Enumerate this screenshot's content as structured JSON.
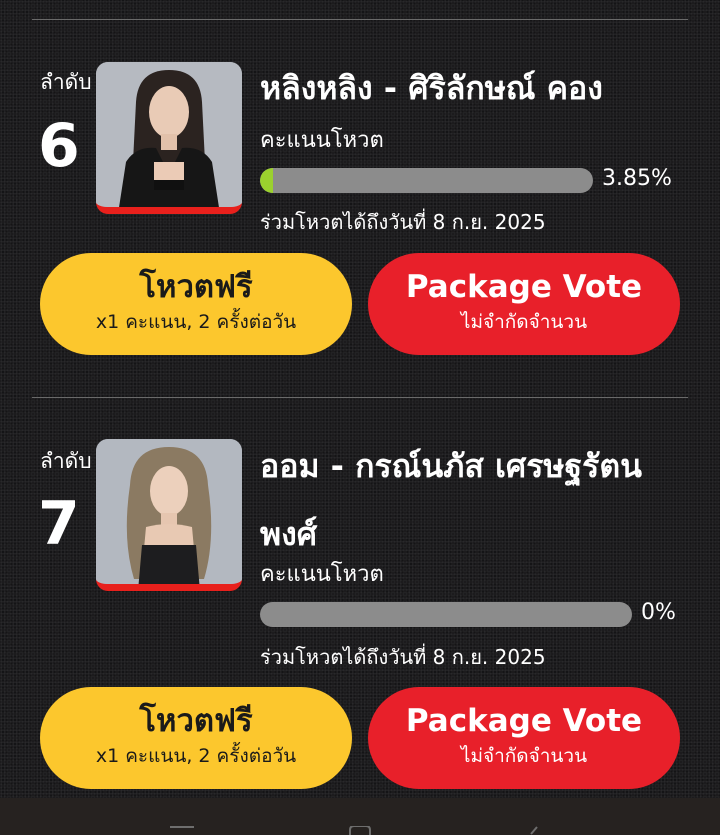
{
  "candidates": [
    {
      "rank_label": "ลำดับ",
      "rank": "6",
      "name": "หลิงหลิง - ศิริลักษณ์ คอง",
      "score_label": "คะแนนโหวต",
      "percent_text": "3.85%",
      "percent_value": 3.85,
      "until_text": "ร่วมโหวตได้ถึงวันที่ 8 ก.ย. 2025",
      "free_vote": {
        "title": "โหวตฟรี",
        "subtitle": "x1 คะแนน, 2 ครั้งต่อวัน"
      },
      "package_vote": {
        "title": "Package Vote",
        "subtitle": "ไม่จำกัดจำนวน"
      }
    },
    {
      "rank_label": "ลำดับ",
      "rank": "7",
      "name": "ออม - กรณ์นภัส เศรษฐรัตนพงศ์",
      "score_label": "คะแนนโหวต",
      "percent_text": "0%",
      "percent_value": 0,
      "until_text": "ร่วมโหวตได้ถึงวันที่ 8 ก.ย. 2025",
      "free_vote": {
        "title": "โหวตฟรี",
        "subtitle": "x1 คะแนน, 2 ครั้งต่อวัน"
      },
      "package_vote": {
        "title": "Package Vote",
        "subtitle": "ไม่จำกัดจำนวน"
      }
    }
  ],
  "colors": {
    "free_button": "#fcc72d",
    "package_button": "#e8202a",
    "progress_fill": "#9bd12e",
    "progress_track": "#8c8c8c",
    "photo_frame_accent": "#e8201c"
  },
  "icons": {
    "nav_left": "menu-icon",
    "nav_center": "home-icon",
    "nav_right": "back-icon"
  }
}
